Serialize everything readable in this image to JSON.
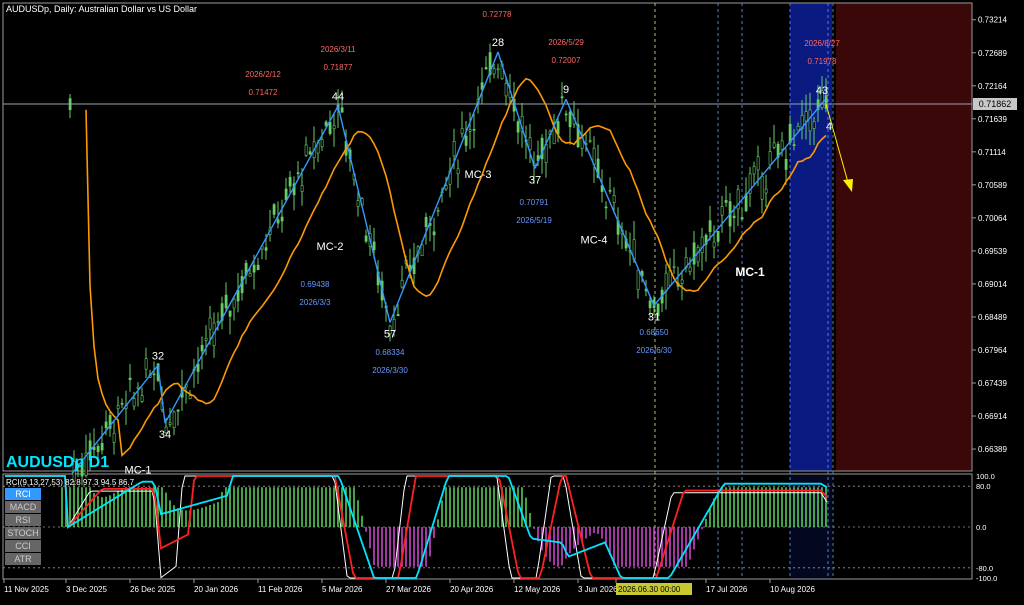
{
  "window": {
    "title": "AUDUSDp, Daily:  Australian Dollar vs US Dollar",
    "watermark": "AUDUSDp D1",
    "watermark_color": "#00e5ff",
    "current_price": "0.71862"
  },
  "colors": {
    "background": "#000000",
    "candle": "#66cc66",
    "ma": "#ff9900",
    "zigzag": "#3399ff",
    "future_zone": "#3a0808",
    "highlight_zone": "#0a1a80",
    "date_label": "#ff6666",
    "date_label_low": "#6699ff",
    "rci_fast": "#ffffff",
    "rci_mid": "#ff2020",
    "rci_slow": "#00e5ff",
    "hist_pos": "#55cc55",
    "hist_neg": "#cc44cc"
  },
  "indicator_panel": {
    "label": "RCI(9,13,27,53) 82.8 97.3 94.5 86.7",
    "buttons": [
      "RCI",
      "MACD",
      "RSI",
      "STOCH",
      "CCI",
      "ATR"
    ],
    "active_button": "RCI",
    "scale": [
      "100.0",
      "80.0",
      "0.0",
      "-80.0",
      "-100.0"
    ]
  },
  "annotations": {
    "points": [
      {
        "label": "32",
        "price": 0.6772
      },
      {
        "label": "34",
        "price": 0.668
      },
      {
        "label": "44",
        "price": 0.7184
      },
      {
        "label": "57",
        "price": 0.684
      },
      {
        "label": "28",
        "price": 0.727
      },
      {
        "label": "37",
        "price": 0.7085
      },
      {
        "label": "9",
        "price": 0.7195
      },
      {
        "label": "31",
        "price": 0.6867
      },
      {
        "label": "43",
        "price": 0.7194
      },
      {
        "label": "4",
        "price": 0.717
      }
    ],
    "waves": [
      {
        "label": "MC-1",
        "price": 0.66
      },
      {
        "label": "MC-2",
        "price": 0.6955
      },
      {
        "label": "MC-3",
        "price": 0.707
      },
      {
        "label": "MC-4",
        "price": 0.6966
      },
      {
        "label": "MC-1",
        "price": 0.6914
      }
    ],
    "top_label": "0.72778",
    "highs": [
      {
        "date": "2026/2/12",
        "price": "0.71472"
      },
      {
        "date": "2026/3/11",
        "price": "0.71877"
      },
      {
        "date": "2026/5/29",
        "price": "0.72007"
      },
      {
        "date": "2026/8/27",
        "price": "0.71978"
      }
    ],
    "lows": [
      {
        "date": "2026/3/3",
        "price": "0.69438"
      },
      {
        "date": "2026/3/30",
        "price": "0.68334"
      },
      {
        "date": "2026/5/19",
        "price": "0.70791"
      },
      {
        "date": "2026/6/30",
        "price": "0.68650"
      }
    ]
  },
  "chart_data": {
    "type": "candlestick",
    "title": "AUDUSDp, Daily:  Australian Dollar vs US Dollar",
    "ylim": [
      0.6604,
      0.7348
    ],
    "y_ticks": [
      "0.73214",
      "0.72689",
      "0.72164",
      "0.71639",
      "0.71114",
      "0.70589",
      "0.70064",
      "0.69539",
      "0.69014",
      "0.68489",
      "0.67964",
      "0.67439",
      "0.66914",
      "0.66389"
    ],
    "x_ticks": [
      "11 Nov 2025",
      "3 Dec 2025",
      "26 Dec 2025",
      "20 Jan 2026",
      "11 Feb 2026",
      "5 Mar 2026",
      "27 Mar 2026",
      "20 Apr 2026",
      "12 May 2026",
      "3 Jun 2026",
      "2026.06.30 00:00",
      "17 Jul 2026",
      "10 Aug 2026"
    ],
    "zigzag_prices": [
      0.66,
      0.6772,
      0.668,
      0.7184,
      0.684,
      0.727,
      0.7085,
      0.7195,
      0.6867,
      0.7194
    ]
  }
}
